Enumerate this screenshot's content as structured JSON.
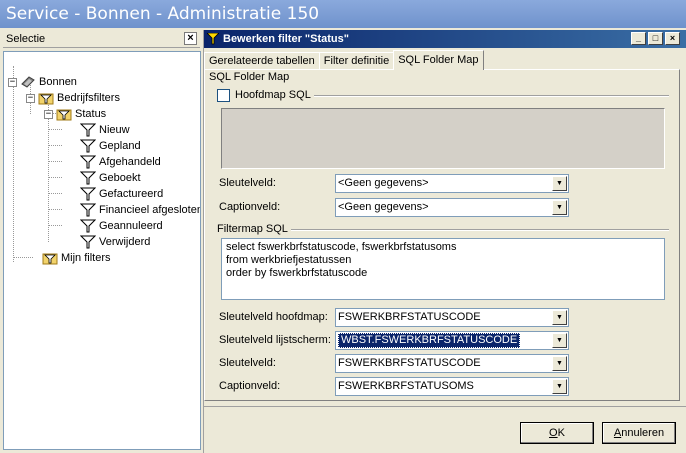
{
  "app": {
    "title": "Service - Bonnen - Administratie 150"
  },
  "left_panel": {
    "title": "Selectie",
    "tree": [
      {
        "label": "Bonnen",
        "level": 0,
        "expander": "-",
        "icon": "diamond-icon"
      },
      {
        "label": "Bedrijfsfilters",
        "level": 1,
        "expander": "-",
        "icon": "folder-filter-icon"
      },
      {
        "label": "Status",
        "level": 2,
        "expander": "-",
        "icon": "folder-filter-icon"
      },
      {
        "label": "Nieuw",
        "level": 3,
        "icon": "filter-icon"
      },
      {
        "label": "Gepland",
        "level": 3,
        "icon": "filter-icon"
      },
      {
        "label": "Afgehandeld",
        "level": 3,
        "icon": "filter-icon"
      },
      {
        "label": "Geboekt",
        "level": 3,
        "icon": "filter-icon"
      },
      {
        "label": "Gefactureerd",
        "level": 3,
        "icon": "filter-icon"
      },
      {
        "label": "Financieel afgesloten",
        "level": 3,
        "icon": "filter-icon"
      },
      {
        "label": "Geannuleerd",
        "level": 3,
        "icon": "filter-icon"
      },
      {
        "label": "Verwijderd",
        "level": 3,
        "icon": "filter-icon"
      },
      {
        "label": "Mijn filters",
        "level": 1,
        "icon": "folder-filter-icon"
      }
    ]
  },
  "dialog": {
    "title": "Bewerken filter \"Status\"",
    "window_buttons": {
      "minimize": "_",
      "maximize": "□",
      "close": "×"
    },
    "tabs": [
      {
        "label": "Gerelateerde tabellen",
        "active": false
      },
      {
        "label": "Filter definitie",
        "active": false
      },
      {
        "label": "SQL Folder Map",
        "active": true
      }
    ],
    "group_title": "SQL Folder Map",
    "hoofdmap_sql": {
      "label": "Hoofdmap SQL",
      "checked": false
    },
    "sleutelveld_1": {
      "label": "Sleutelveld:",
      "value": "<Geen gegevens>"
    },
    "captionveld_1": {
      "label": "Captionveld:",
      "value": "<Geen gegevens>"
    },
    "filtermap_sql": {
      "label": "Filtermap SQL",
      "lines": [
        "select fswerkbrfstatuscode, fswerkbrfstatusoms",
        "from werkbriefjestatussen",
        "order by fswerkbrfstatuscode"
      ]
    },
    "sleutelveld_hoofdmap": {
      "label": "Sleutelveld hoofdmap:",
      "value": "FSWERKBRFSTATUSCODE"
    },
    "sleutelveld_lijstscherm": {
      "label": "Sleutelveld lijstscherm:",
      "value": "WBST.FSWERKBRFSTATUSCODE"
    },
    "sleutelveld_2": {
      "label": "Sleutelveld:",
      "value": "FSWERKBRFSTATUSCODE"
    },
    "captionveld_2": {
      "label": "Captionveld:",
      "value": "FSWERKBRFSTATUSOMS"
    },
    "ok_button": {
      "label_prefix": "",
      "label_underlined": "O",
      "label_rest": "K"
    },
    "cancel_button": {
      "label_prefix": "",
      "label_underlined": "A",
      "label_rest": "nnuleren"
    }
  },
  "colors": {
    "title_bar": "#6f92cc",
    "dialog_title": "#0a246a",
    "selection": "#0a246a"
  }
}
